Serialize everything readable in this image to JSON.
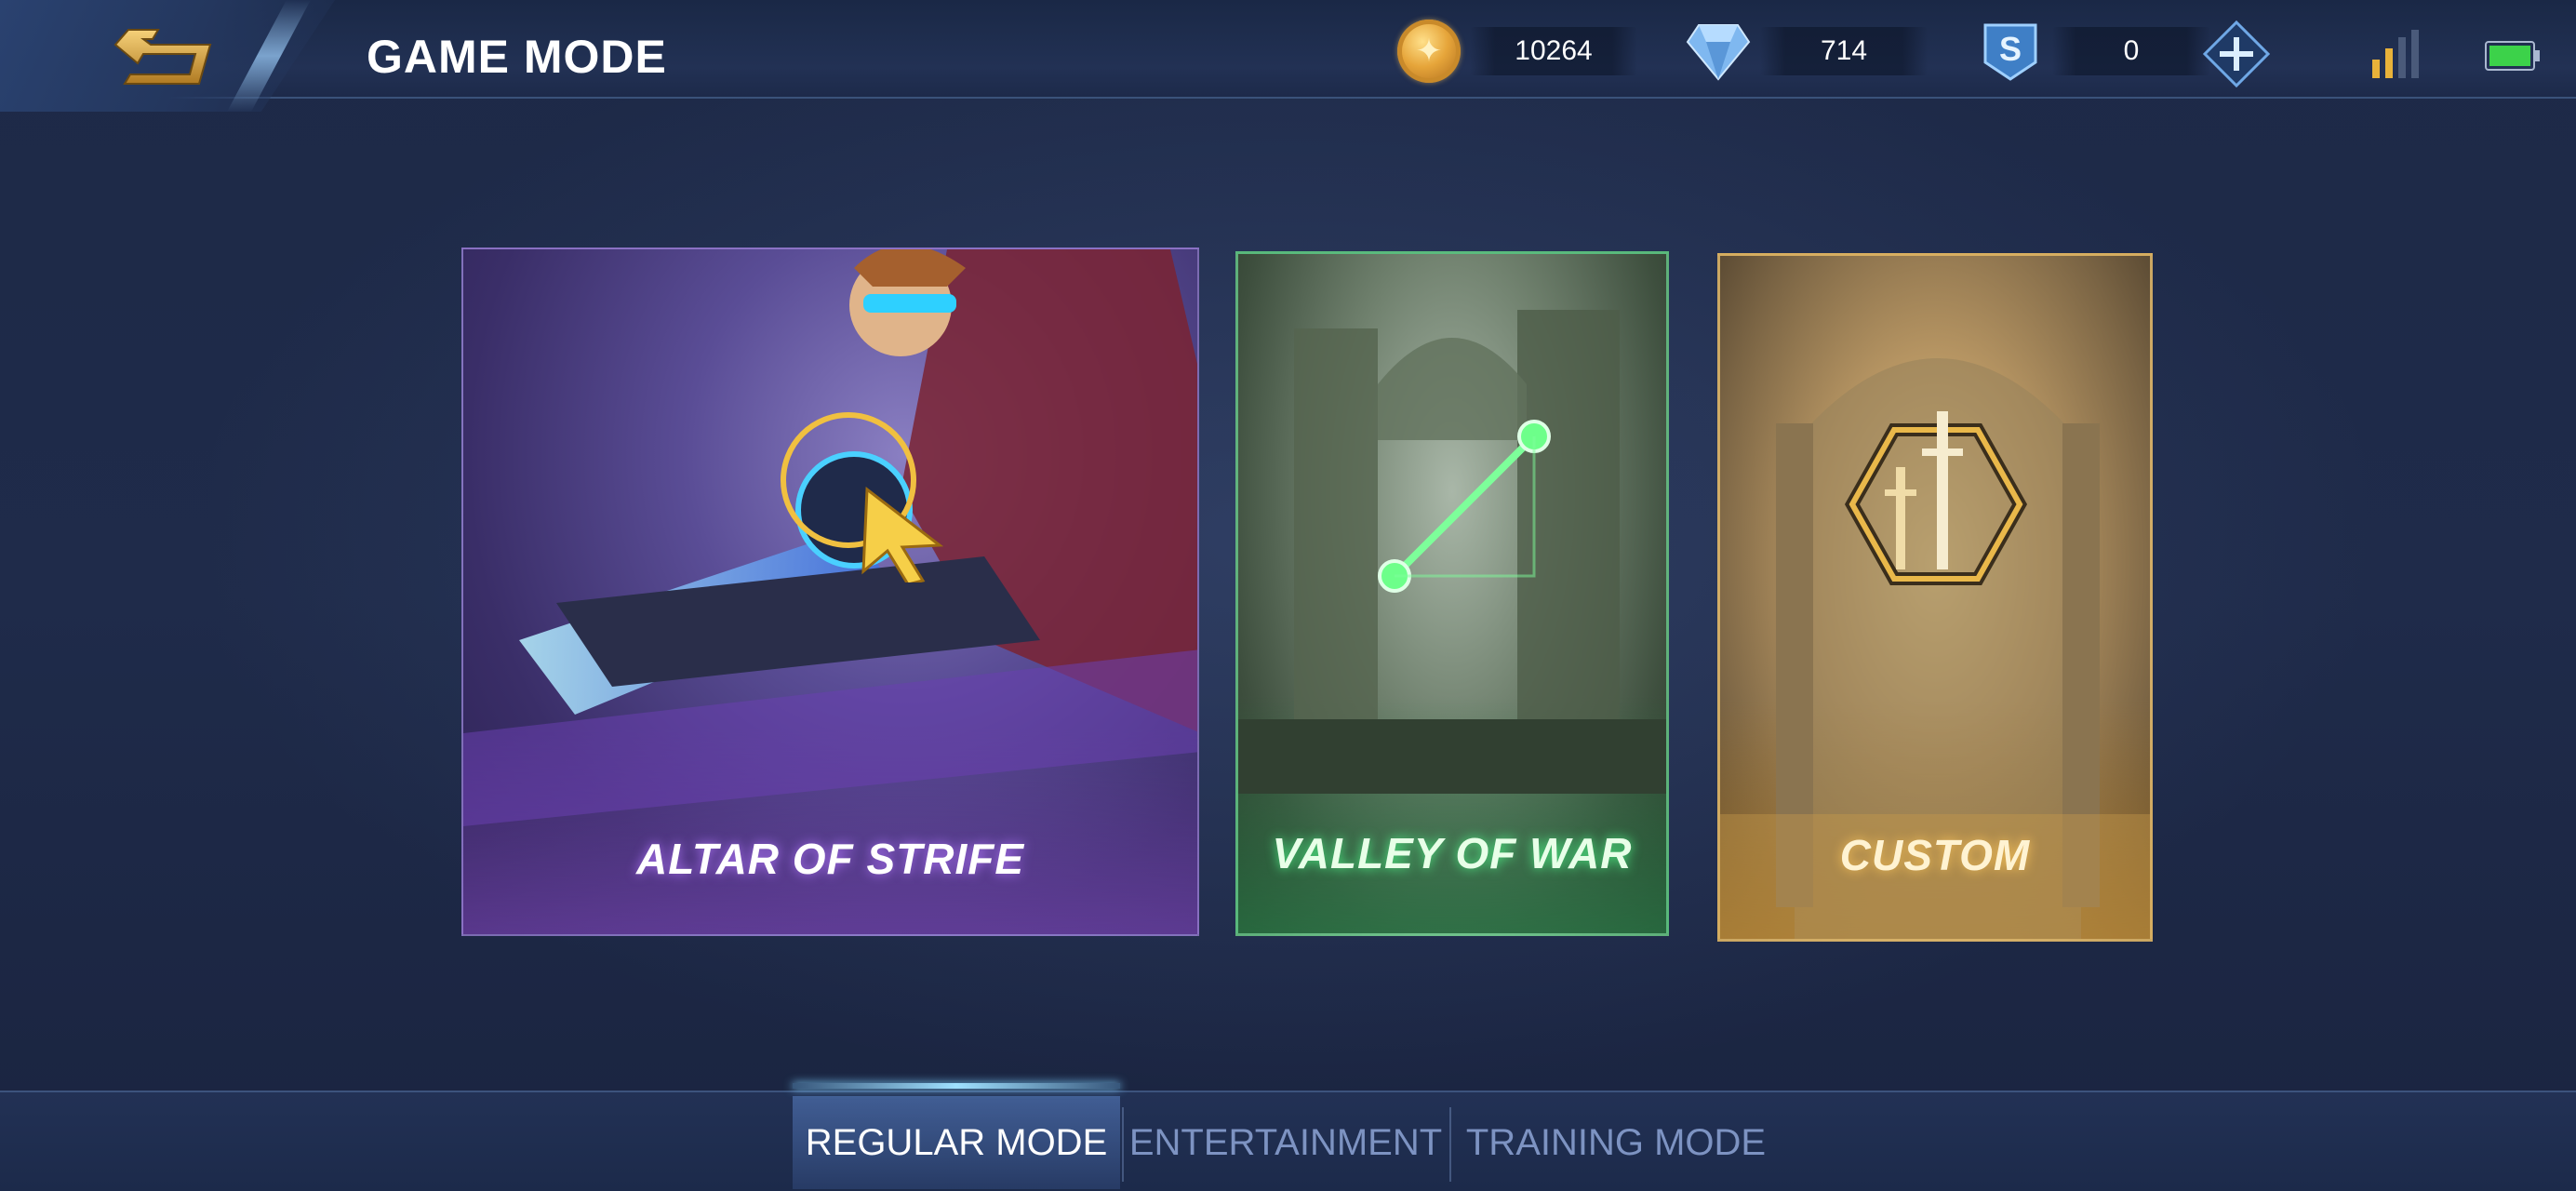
{
  "header": {
    "title": "GAME MODE",
    "currencies": [
      {
        "icon": "gold-coin-icon",
        "value": "10264"
      },
      {
        "icon": "diamond-icon",
        "value": "714"
      },
      {
        "icon": "ticket-icon",
        "value": "0"
      }
    ]
  },
  "modes": [
    {
      "label": "ALTAR OF STRIFE",
      "accent": "#8a6cff"
    },
    {
      "label": "VALLEY OF WAR",
      "accent": "#4cff8a"
    },
    {
      "label": "CUSTOM",
      "accent": "#ffcc66"
    }
  ],
  "tabs": [
    {
      "label": "REGULAR MODE",
      "active": true
    },
    {
      "label": "ENTERTAINMENT",
      "active": false
    },
    {
      "label": "TRAINING MODE",
      "active": false
    }
  ],
  "colors": {
    "background": "#1f2b4a",
    "active_tab_text": "#ffffff",
    "inactive_tab_text": "#7d93c2",
    "battery": "#3cd24a",
    "signal": "#e8b23a"
  }
}
